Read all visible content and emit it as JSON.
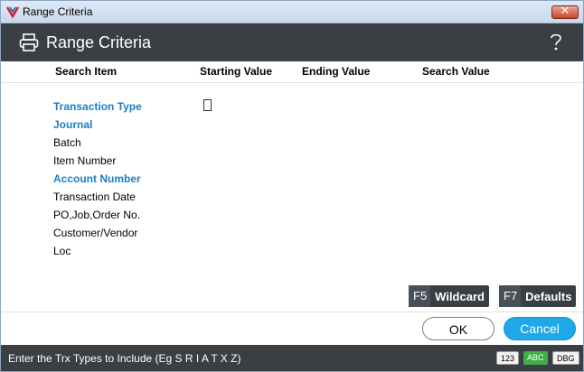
{
  "window": {
    "title": "Range Criteria",
    "close_glyph": "✕"
  },
  "header": {
    "title": "Range Criteria"
  },
  "columns": {
    "search_item": "Search Item",
    "starting_value": "Starting Value",
    "ending_value": "Ending Value",
    "search_value": "Search Value"
  },
  "items": [
    {
      "label": "Transaction Type",
      "active": true
    },
    {
      "label": "Journal",
      "active": true
    },
    {
      "label": "Batch",
      "active": false
    },
    {
      "label": "Item Number",
      "active": false
    },
    {
      "label": "Account Number",
      "active": true
    },
    {
      "label": "Transaction Date",
      "active": false
    },
    {
      "label": "PO,Job,Order No.",
      "active": false
    },
    {
      "label": "Customer/Vendor",
      "active": false
    },
    {
      "label": "Loc",
      "active": false
    }
  ],
  "function_buttons": {
    "wildcard": {
      "key": "F5",
      "label": "Wildcard"
    },
    "defaults": {
      "key": "F7",
      "label": "Defaults"
    }
  },
  "buttons": {
    "ok": "OK",
    "cancel": "Cancel"
  },
  "status": {
    "message": "Enter the Trx Types to Include (Eg S R I A T X Z)",
    "badges": {
      "num": "123",
      "abc": "ABC",
      "dbg": "DBG"
    }
  },
  "colors": {
    "accent": "#1b7fc4",
    "header_bg": "#3a3f44",
    "cancel_bg": "#1fa8e8",
    "abc_badge": "#3fae49"
  },
  "icons": {
    "app": "app-logo-icon",
    "printer": "printer-icon",
    "help": "help-icon",
    "close": "close-icon"
  }
}
